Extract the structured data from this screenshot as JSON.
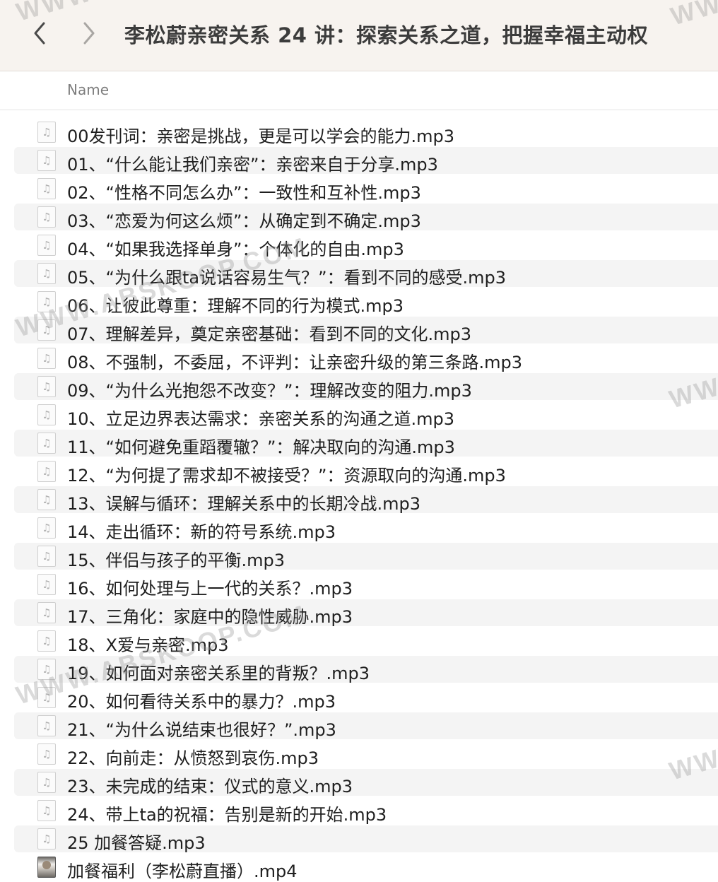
{
  "window": {
    "title": "李松蔚亲密关系 24 讲：探索关系之道，把握幸福主动权"
  },
  "list_header": {
    "name_column": "Name"
  },
  "files": [
    {
      "name": "00发刊词：亲密是挑战，更是可以学会的能力.mp3",
      "icon": "audio-file-icon"
    },
    {
      "name": "01、“什么能让我们亲密”：亲密来自于分享.mp3",
      "icon": "audio-file-icon"
    },
    {
      "name": "02、“性格不同怎么办”：一致性和互补性.mp3",
      "icon": "audio-file-icon"
    },
    {
      "name": "03、“恋爱为何这么烦”：从确定到不确定.mp3",
      "icon": "audio-file-icon"
    },
    {
      "name": "04、“如果我选择单身”：个体化的自由.mp3",
      "icon": "audio-file-icon"
    },
    {
      "name": "05、“为什么跟ta说话容易生气？”：看到不同的感受.mp3",
      "icon": "audio-file-icon"
    },
    {
      "name": "06、让彼此尊重：理解不同的行为模式.mp3",
      "icon": "audio-file-icon"
    },
    {
      "name": "07、理解差异，奠定亲密基础：看到不同的文化.mp3",
      "icon": "audio-file-icon"
    },
    {
      "name": "08、不强制，不委屈，不评判：让亲密升级的第三条路.mp3",
      "icon": "audio-file-icon"
    },
    {
      "name": "09、“为什么光抱怨不改变？”：理解改变的阻力.mp3",
      "icon": "audio-file-icon"
    },
    {
      "name": "10、立足边界表达需求：亲密关系的沟通之道.mp3",
      "icon": "audio-file-icon"
    },
    {
      "name": "11、“如何避免重蹈覆辙？”：解决取向的沟通.mp3",
      "icon": "audio-file-icon"
    },
    {
      "name": "12、“为何提了需求却不被接受？”：资源取向的沟通.mp3",
      "icon": "audio-file-icon"
    },
    {
      "name": "13、误解与循环：理解关系中的长期冷战.mp3",
      "icon": "audio-file-icon"
    },
    {
      "name": "14、走出循环：新的符号系统.mp3",
      "icon": "audio-file-icon"
    },
    {
      "name": "15、伴侣与孩子的平衡.mp3",
      "icon": "audio-file-icon"
    },
    {
      "name": "16、如何处理与上一代的关系？.mp3",
      "icon": "audio-file-icon"
    },
    {
      "name": "17、三角化：家庭中的隐性威胁.mp3",
      "icon": "audio-file-icon"
    },
    {
      "name": "18、X爱与亲密.mp3",
      "icon": "audio-file-icon"
    },
    {
      "name": "19、如何面对亲密关系里的背叛？.mp3",
      "icon": "audio-file-icon"
    },
    {
      "name": "20、如何看待关系中的暴力？.mp3",
      "icon": "audio-file-icon"
    },
    {
      "name": "21、“为什么说结束也很好？”.mp3",
      "icon": "audio-file-icon"
    },
    {
      "name": "22、向前走：从愤怒到哀伤.mp3",
      "icon": "audio-file-icon"
    },
    {
      "name": "23、未完成的结束：仪式的意义.mp3",
      "icon": "audio-file-icon"
    },
    {
      "name": "24、带上ta的祝福：告别是新的开始.mp3",
      "icon": "audio-file-icon"
    },
    {
      "name": "25 加餐答疑.mp3",
      "icon": "audio-file-icon"
    },
    {
      "name": "加餐福利（李松蔚直播）.mp4",
      "icon": "video-file-icon"
    }
  ],
  "watermark": {
    "text": "WWW.ABSKOOP.COM",
    "edge_text": "WWW"
  },
  "colors": {
    "toolbar_bg": "#f7f3ef",
    "alt_row": "#f4f4f4",
    "title_text": "#3c3c3c"
  }
}
